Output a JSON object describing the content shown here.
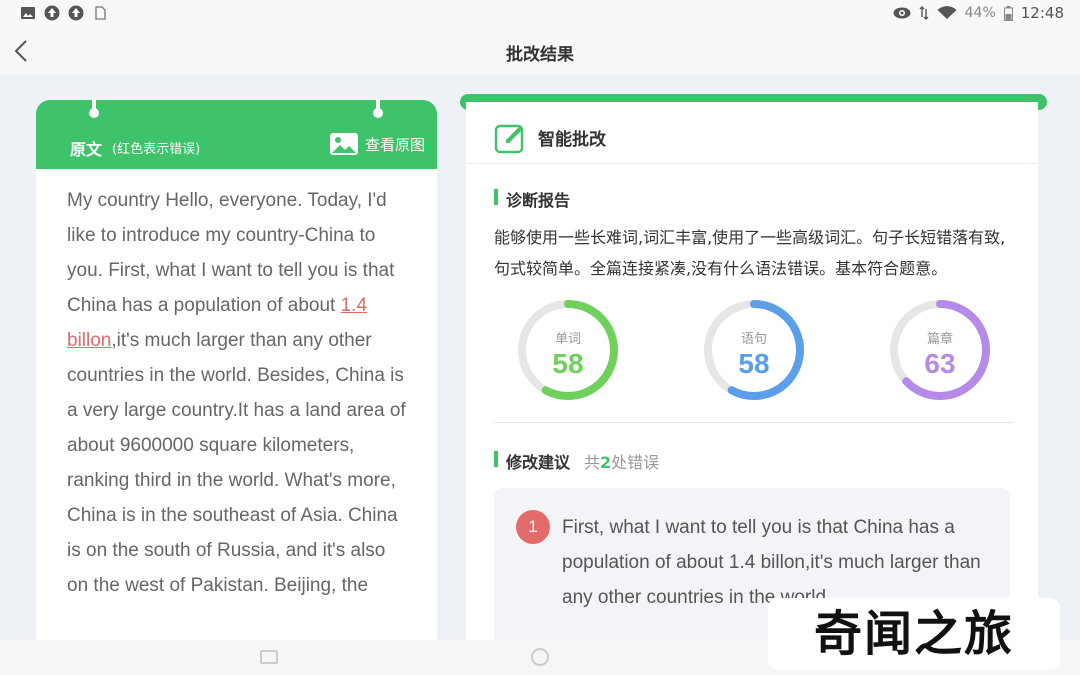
{
  "status_bar": {
    "battery": "44%",
    "time": "12:48",
    "left_icons": [
      "image-icon",
      "upload-icon",
      "upload-icon",
      "sd-card-icon"
    ],
    "right_icons": [
      "eye-icon",
      "data-arrows-icon",
      "wifi-icon",
      "battery-icon"
    ]
  },
  "header": {
    "title": "批改结果"
  },
  "left_panel": {
    "title": "原文",
    "subtitle": "(红色表示错误)",
    "view_original_label": "查看原图",
    "essay": {
      "before_error": "My country  Hello, everyone. Today, I'd like to introduce my country-China to you.  First, what I want to tell you is that China has a population of about ",
      "error": "1.4 billon",
      "after_error": ",it's much larger than any other countries in the world. Besides, China is a very large country.It has a land area of about 9600000 square kilometers, ranking third in the world. What's more, China is in the southeast of Asia. China is on the south of Russia, and it's also on the west of Pakistan. Beijing, the"
    }
  },
  "right_panel": {
    "title": "智能批改",
    "diagnosis": {
      "heading": "诊断报告",
      "text": "能够使用一些长难词,词汇丰富,使用了一些高级词汇。句子长短错落有致,句式较简单。全篇连接紧凑,没有什么语法错误。基本符合题意。"
    },
    "scores": [
      {
        "label": "单词",
        "value": 58,
        "max": 100,
        "color": "#6fd05b"
      },
      {
        "label": "语句",
        "value": 58,
        "max": 100,
        "color": "#5a9fe8"
      },
      {
        "label": "篇章",
        "value": 63,
        "max": 100,
        "color": "#b58ae8"
      }
    ],
    "suggestions": {
      "heading": "修改建议",
      "count_prefix": "共",
      "count": "2",
      "count_suffix": "处错误",
      "items": [
        {
          "number": "1",
          "text": "First, what I want to tell you is that China has a population of about 1.4 billon,it's much larger than any other countries in the world."
        }
      ]
    }
  },
  "watermark": "奇闻之旅",
  "colors": {
    "accent": "#3ec26a",
    "error": "#e06a6a"
  }
}
